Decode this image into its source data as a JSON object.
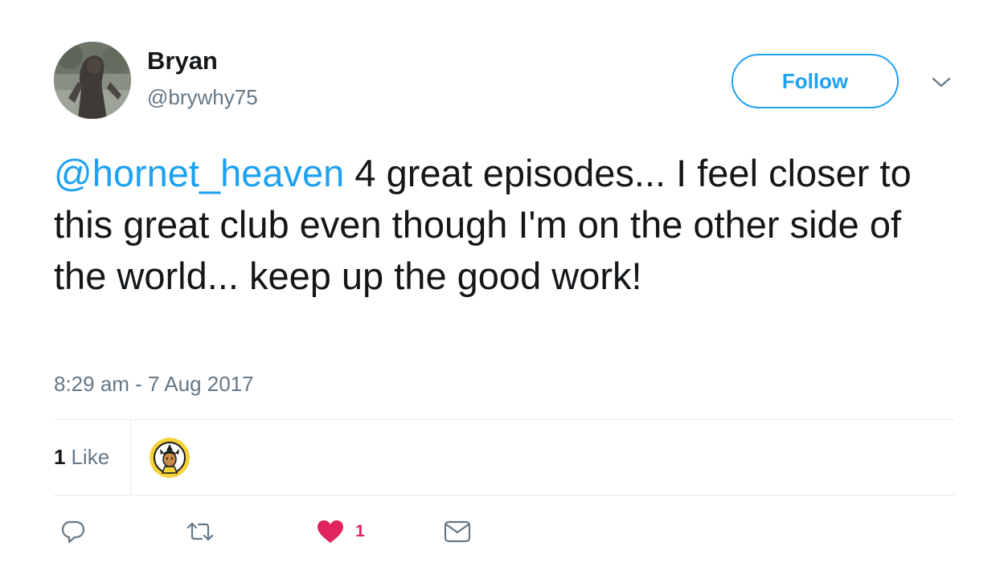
{
  "author": {
    "name": "Bryan",
    "handle": "@brywhy75"
  },
  "follow_button": {
    "label": "Follow"
  },
  "tweet": {
    "mention": "@hornet_heaven",
    "body": " 4 great episodes... I feel closer to this great club even though I'm on the other side of the world... keep up the good work!",
    "timestamp": "8:29 am - 7 Aug 2017"
  },
  "stats": {
    "likes_count": "1",
    "likes_label": "Like"
  },
  "actions": {
    "like_count": "1"
  },
  "colors": {
    "accent": "#1da1f2",
    "like": "#e0245e",
    "muted": "#657786",
    "text": "#14171a",
    "border": "#e6ecf0"
  },
  "icons": {
    "reply": "reply-icon",
    "retweet": "retweet-icon",
    "like": "heart-icon",
    "dm": "envelope-icon",
    "more": "chevron-down-icon"
  }
}
